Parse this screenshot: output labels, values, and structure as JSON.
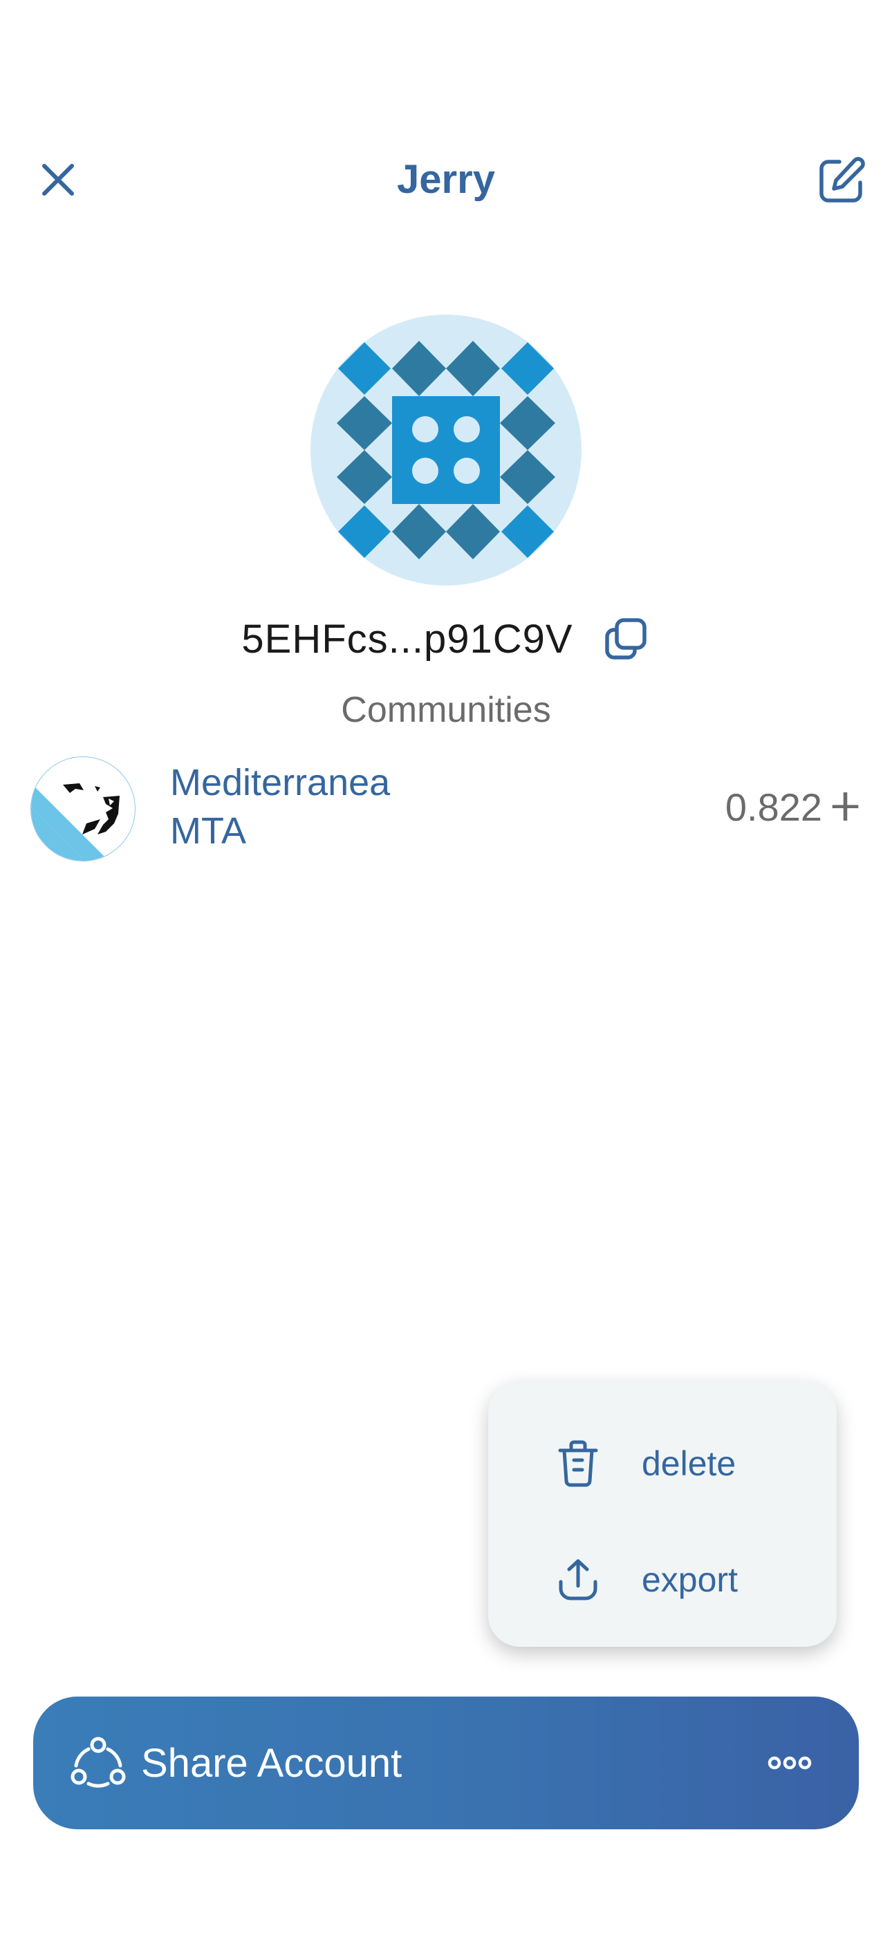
{
  "header": {
    "title": "Jerry",
    "close_icon": "close-icon",
    "edit_icon": "edit-icon"
  },
  "account": {
    "address": "5EHFcs...p91C9V",
    "copy_icon": "copy-icon",
    "avatar_icon": "identicon"
  },
  "communities": {
    "heading": "Communities",
    "items": [
      {
        "name": "Mediterranea",
        "symbol": "MTA",
        "balance": "0.822",
        "currency_symbol": "ⵜ",
        "logo_icon": "mediterranea-logo"
      }
    ]
  },
  "menu": {
    "items": [
      {
        "label": "delete",
        "icon": "trash-icon"
      },
      {
        "label": "export",
        "icon": "upload-icon"
      }
    ]
  },
  "bottom_bar": {
    "share_label": "Share Account",
    "share_icon": "share-icon",
    "more_icon": "more-icon"
  },
  "colors": {
    "primary": "#35669f",
    "text_dark": "#1a1a1a",
    "text_grey": "#6b6b6b",
    "avatar_bg": "#d4ebf7",
    "menu_bg": "#f1f5f6",
    "bar_gradient_start": "#3a7db8",
    "bar_gradient_end": "#3a62a6"
  }
}
